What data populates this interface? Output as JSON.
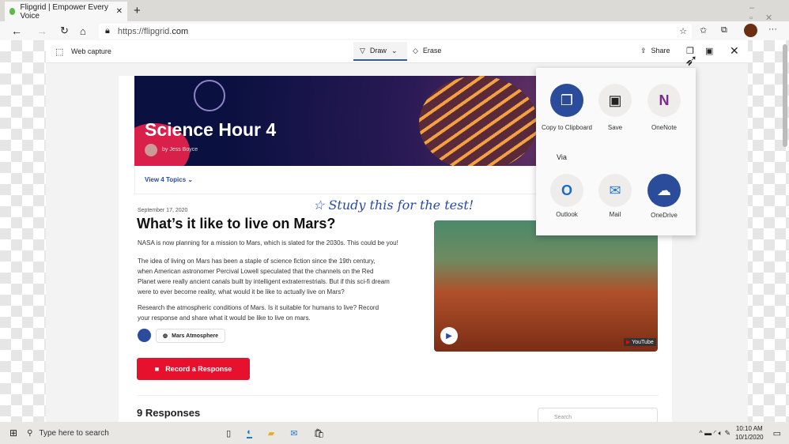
{
  "browser": {
    "tab_title": "Flipgrid | Empower Every Voice",
    "url_prefix": "https://flipgrid.",
    "url_domain": "com"
  },
  "capture_toolbar": {
    "title": "Web capture",
    "draw": "Draw",
    "erase": "Erase",
    "share": "Share"
  },
  "banner": {
    "title": "Science Hour 4",
    "author": "by Jess Boyce"
  },
  "topics_link": "View 4 Topics",
  "annotation": "Study this for the test!",
  "topic": {
    "date": "September 17, 2020",
    "title": "What’s it like to live on Mars?",
    "paragraphs": [
      "NASA is now planning for a mission to Mars, which is slated for the 2030s. This could be you!",
      "The idea of living on Mars has been a staple of science fiction since the 19th century, when American astronomer Percival Lowell speculated that the channels on the Red Planet were really ancient canals built by intelligent extraterrestrials. But if this sci-fi dream were to ever become reality, what would it be like to actually live on Mars?",
      "Research the atmospheric conditions of Mars. Is it suitable for humans to live? Record your response and share what it would be like to live on mars."
    ],
    "resource": "Mars Atmosphere",
    "record_button": "Record a Response",
    "video_badge": "YouTube"
  },
  "responses": {
    "title": "9 Responses",
    "search_placeholder": "Search"
  },
  "share_popup": {
    "items": [
      {
        "label": "Copy to Clipboard",
        "icon": "copy-icon"
      },
      {
        "label": "Save",
        "icon": "save-icon"
      },
      {
        "label": "OneNote",
        "icon": "onenote-icon"
      }
    ],
    "via": "Via",
    "via_items": [
      {
        "label": "Outlook",
        "icon": "outlook-icon"
      },
      {
        "label": "Mail",
        "icon": "mail-icon"
      },
      {
        "label": "OneDrive",
        "icon": "onedrive-icon"
      }
    ]
  },
  "taskbar": {
    "search_placeholder": "Type here to search",
    "time": "10:10 AM",
    "date": "10/1/2020"
  },
  "colors": {
    "accent": "#2b4c9b",
    "record": "#e8112d"
  }
}
